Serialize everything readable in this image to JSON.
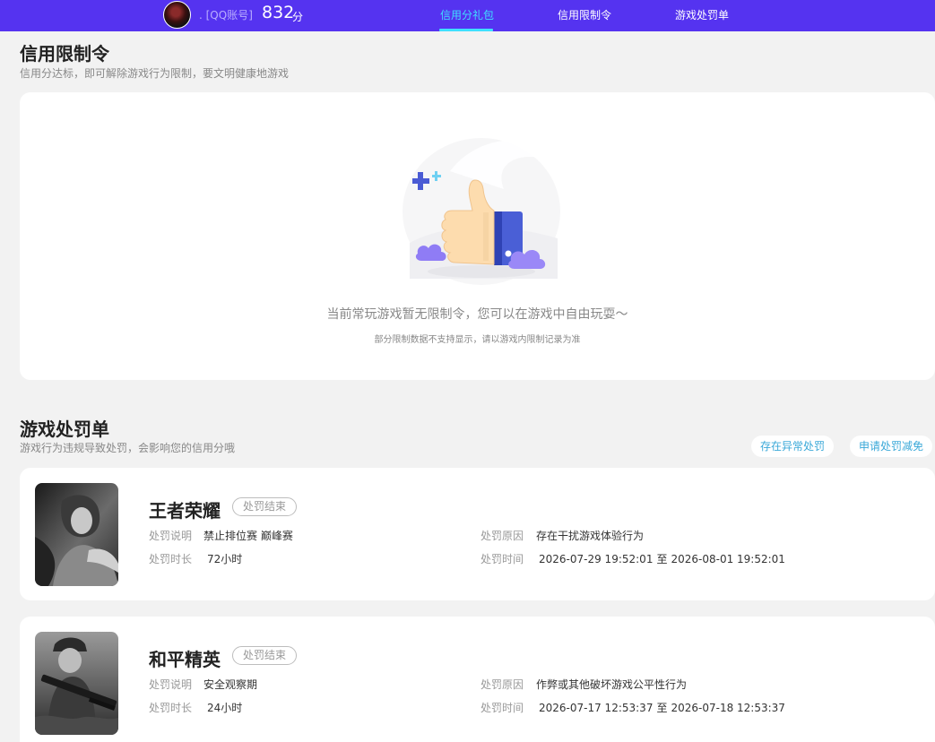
{
  "header": {
    "account_label": ". [QQ账号]",
    "score": "832",
    "score_unit": "分",
    "tabs": [
      {
        "label": "信用分礼包",
        "active": true
      },
      {
        "label": "信用限制令",
        "active": false
      },
      {
        "label": "游戏处罚单",
        "active": false
      }
    ],
    "colors": {
      "bar": "#5533f0",
      "active_tab": "#3fe0ff"
    }
  },
  "restriction": {
    "title": "信用限制令",
    "subtitle": "信用分达标，即可解除游戏行为限制，要文明健康地游戏",
    "empty_icon": "thumbs-up-illustration",
    "empty_message": "当前常玩游戏暂无限制令，您可以在游戏中自由玩耍～",
    "empty_note": "部分限制数据不支持显示，请以游戏内限制记录为准"
  },
  "penalty": {
    "title": "游戏处罚单",
    "subtitle": "游戏行为违规导致处罚，会影响您的信用分哦",
    "buttons": {
      "abnormal": "存在异常处罚",
      "reduce": "申请处罚减免"
    },
    "labels": {
      "description": "处罚说明",
      "duration": "处罚时长",
      "reason": "处罚原因",
      "time": "处罚时间",
      "to": "至"
    },
    "items": [
      {
        "game": "王者荣耀",
        "status": "处罚结束",
        "description": "禁止排位赛 巅峰赛",
        "duration": "72小时",
        "reason": "存在干扰游戏体验行为",
        "start": "2026-07-29 19:52:01",
        "end": "2026-08-01 19:52:01"
      },
      {
        "game": "和平精英",
        "status": "处罚结束",
        "description": "安全观察期",
        "duration": "24小时",
        "reason": "作弊或其他破坏游戏公平性行为",
        "start": "2026-07-17 12:53:37",
        "end": "2026-07-18 12:53:37"
      }
    ]
  }
}
